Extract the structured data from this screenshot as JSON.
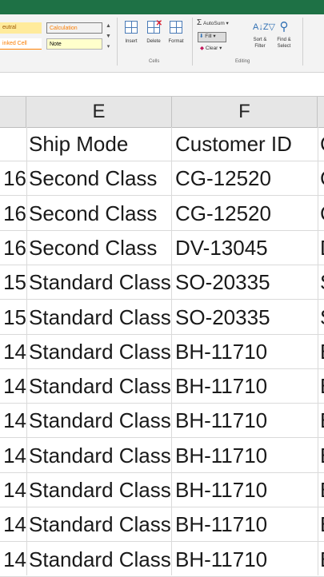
{
  "ribbon": {
    "styles": {
      "neutral": "eutral",
      "calculation": "Calculation",
      "linked": "inked Cell",
      "note": "Note"
    },
    "cells": {
      "insert": "Insert",
      "delete": "Delete",
      "format": "Format",
      "group_label": "Cells"
    },
    "editing": {
      "autosum": "AutoSum",
      "fill": "Fill",
      "clear": "Clear",
      "sort_filter": "Sort & Filter",
      "find_select": "Find & Select",
      "group_label": "Editing"
    }
  },
  "columns": {
    "e": "E",
    "f": "F"
  },
  "rows": [
    {
      "d": "",
      "e": "Ship Mode",
      "f": "Customer ID",
      "g": "C"
    },
    {
      "d": "16",
      "e": "Second Class",
      "f": "CG-12520",
      "g": "C"
    },
    {
      "d": "16",
      "e": "Second Class",
      "f": "CG-12520",
      "g": "C"
    },
    {
      "d": "16",
      "e": "Second Class",
      "f": "DV-13045",
      "g": "D"
    },
    {
      "d": "15",
      "e": "Standard Class",
      "f": "SO-20335",
      "g": "S"
    },
    {
      "d": "15",
      "e": "Standard Class",
      "f": "SO-20335",
      "g": "S"
    },
    {
      "d": "14",
      "e": "Standard Class",
      "f": "BH-11710",
      "g": "B"
    },
    {
      "d": "14",
      "e": "Standard Class",
      "f": "BH-11710",
      "g": "B"
    },
    {
      "d": "14",
      "e": "Standard Class",
      "f": "BH-11710",
      "g": "B"
    },
    {
      "d": "14",
      "e": "Standard Class",
      "f": "BH-11710",
      "g": "B"
    },
    {
      "d": "14",
      "e": "Standard Class",
      "f": "BH-11710",
      "g": "B"
    },
    {
      "d": "14",
      "e": "Standard Class",
      "f": "BH-11710",
      "g": "B"
    },
    {
      "d": "14",
      "e": "Standard Class",
      "f": "BH-11710",
      "g": "B"
    }
  ]
}
